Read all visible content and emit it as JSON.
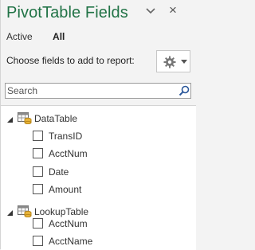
{
  "header": {
    "title": "PivotTable Fields",
    "chevron_icon": "chevron-down-icon",
    "close_icon": "close-icon",
    "close_glyph": "×"
  },
  "tabs": [
    {
      "label": "Active",
      "selected": false
    },
    {
      "label": "All",
      "selected": true
    }
  ],
  "choose_fields_label": "Choose fields to add to report:",
  "tools_button": {
    "icon": "gear-icon",
    "caret_icon": "caret-down-icon"
  },
  "search": {
    "placeholder": "Search",
    "value": "",
    "icon": "search-icon"
  },
  "field_list": {
    "tables": [
      {
        "name": "DataTable",
        "expanded": true,
        "fields": [
          {
            "label": "TransID",
            "checked": false
          },
          {
            "label": "AcctNum",
            "checked": false
          },
          {
            "label": "Date",
            "checked": false
          },
          {
            "label": "Amount",
            "checked": false
          }
        ]
      },
      {
        "name": "LookupTable",
        "expanded": true,
        "fields": [
          {
            "label": "AcctNum",
            "checked": false
          },
          {
            "label": "AcctName",
            "checked": false
          }
        ]
      }
    ]
  },
  "colors": {
    "accent": "#217346",
    "background": "#f3f3f3",
    "list_background": "#ffffff"
  }
}
